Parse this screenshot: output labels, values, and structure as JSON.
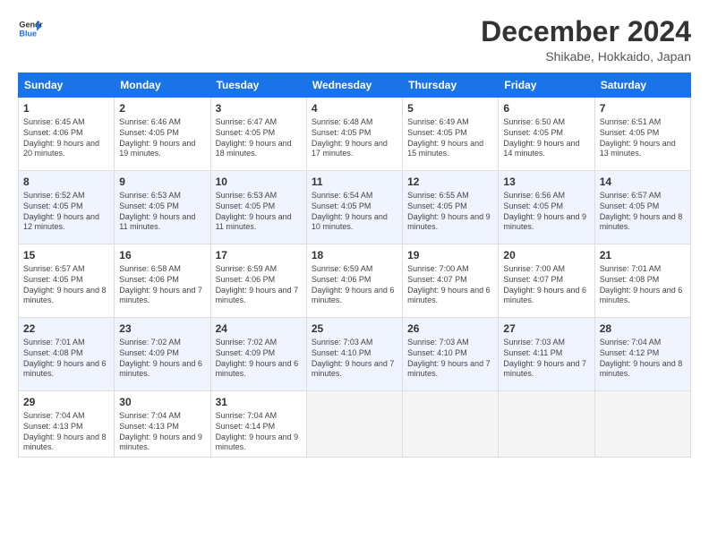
{
  "logo": {
    "line1": "General",
    "line2": "Blue"
  },
  "title": "December 2024",
  "location": "Shikabe, Hokkaido, Japan",
  "weekdays": [
    "Sunday",
    "Monday",
    "Tuesday",
    "Wednesday",
    "Thursday",
    "Friday",
    "Saturday"
  ],
  "weeks": [
    [
      {
        "day": "1",
        "sunrise": "Sunrise: 6:45 AM",
        "sunset": "Sunset: 4:06 PM",
        "daylight": "Daylight: 9 hours and 20 minutes."
      },
      {
        "day": "2",
        "sunrise": "Sunrise: 6:46 AM",
        "sunset": "Sunset: 4:05 PM",
        "daylight": "Daylight: 9 hours and 19 minutes."
      },
      {
        "day": "3",
        "sunrise": "Sunrise: 6:47 AM",
        "sunset": "Sunset: 4:05 PM",
        "daylight": "Daylight: 9 hours and 18 minutes."
      },
      {
        "day": "4",
        "sunrise": "Sunrise: 6:48 AM",
        "sunset": "Sunset: 4:05 PM",
        "daylight": "Daylight: 9 hours and 17 minutes."
      },
      {
        "day": "5",
        "sunrise": "Sunrise: 6:49 AM",
        "sunset": "Sunset: 4:05 PM",
        "daylight": "Daylight: 9 hours and 15 minutes."
      },
      {
        "day": "6",
        "sunrise": "Sunrise: 6:50 AM",
        "sunset": "Sunset: 4:05 PM",
        "daylight": "Daylight: 9 hours and 14 minutes."
      },
      {
        "day": "7",
        "sunrise": "Sunrise: 6:51 AM",
        "sunset": "Sunset: 4:05 PM",
        "daylight": "Daylight: 9 hours and 13 minutes."
      }
    ],
    [
      {
        "day": "8",
        "sunrise": "Sunrise: 6:52 AM",
        "sunset": "Sunset: 4:05 PM",
        "daylight": "Daylight: 9 hours and 12 minutes."
      },
      {
        "day": "9",
        "sunrise": "Sunrise: 6:53 AM",
        "sunset": "Sunset: 4:05 PM",
        "daylight": "Daylight: 9 hours and 11 minutes."
      },
      {
        "day": "10",
        "sunrise": "Sunrise: 6:53 AM",
        "sunset": "Sunset: 4:05 PM",
        "daylight": "Daylight: 9 hours and 11 minutes."
      },
      {
        "day": "11",
        "sunrise": "Sunrise: 6:54 AM",
        "sunset": "Sunset: 4:05 PM",
        "daylight": "Daylight: 9 hours and 10 minutes."
      },
      {
        "day": "12",
        "sunrise": "Sunrise: 6:55 AM",
        "sunset": "Sunset: 4:05 PM",
        "daylight": "Daylight: 9 hours and 9 minutes."
      },
      {
        "day": "13",
        "sunrise": "Sunrise: 6:56 AM",
        "sunset": "Sunset: 4:05 PM",
        "daylight": "Daylight: 9 hours and 9 minutes."
      },
      {
        "day": "14",
        "sunrise": "Sunrise: 6:57 AM",
        "sunset": "Sunset: 4:05 PM",
        "daylight": "Daylight: 9 hours and 8 minutes."
      }
    ],
    [
      {
        "day": "15",
        "sunrise": "Sunrise: 6:57 AM",
        "sunset": "Sunset: 4:05 PM",
        "daylight": "Daylight: 9 hours and 8 minutes."
      },
      {
        "day": "16",
        "sunrise": "Sunrise: 6:58 AM",
        "sunset": "Sunset: 4:06 PM",
        "daylight": "Daylight: 9 hours and 7 minutes."
      },
      {
        "day": "17",
        "sunrise": "Sunrise: 6:59 AM",
        "sunset": "Sunset: 4:06 PM",
        "daylight": "Daylight: 9 hours and 7 minutes."
      },
      {
        "day": "18",
        "sunrise": "Sunrise: 6:59 AM",
        "sunset": "Sunset: 4:06 PM",
        "daylight": "Daylight: 9 hours and 6 minutes."
      },
      {
        "day": "19",
        "sunrise": "Sunrise: 7:00 AM",
        "sunset": "Sunset: 4:07 PM",
        "daylight": "Daylight: 9 hours and 6 minutes."
      },
      {
        "day": "20",
        "sunrise": "Sunrise: 7:00 AM",
        "sunset": "Sunset: 4:07 PM",
        "daylight": "Daylight: 9 hours and 6 minutes."
      },
      {
        "day": "21",
        "sunrise": "Sunrise: 7:01 AM",
        "sunset": "Sunset: 4:08 PM",
        "daylight": "Daylight: 9 hours and 6 minutes."
      }
    ],
    [
      {
        "day": "22",
        "sunrise": "Sunrise: 7:01 AM",
        "sunset": "Sunset: 4:08 PM",
        "daylight": "Daylight: 9 hours and 6 minutes."
      },
      {
        "day": "23",
        "sunrise": "Sunrise: 7:02 AM",
        "sunset": "Sunset: 4:09 PM",
        "daylight": "Daylight: 9 hours and 6 minutes."
      },
      {
        "day": "24",
        "sunrise": "Sunrise: 7:02 AM",
        "sunset": "Sunset: 4:09 PM",
        "daylight": "Daylight: 9 hours and 6 minutes."
      },
      {
        "day": "25",
        "sunrise": "Sunrise: 7:03 AM",
        "sunset": "Sunset: 4:10 PM",
        "daylight": "Daylight: 9 hours and 7 minutes."
      },
      {
        "day": "26",
        "sunrise": "Sunrise: 7:03 AM",
        "sunset": "Sunset: 4:10 PM",
        "daylight": "Daylight: 9 hours and 7 minutes."
      },
      {
        "day": "27",
        "sunrise": "Sunrise: 7:03 AM",
        "sunset": "Sunset: 4:11 PM",
        "daylight": "Daylight: 9 hours and 7 minutes."
      },
      {
        "day": "28",
        "sunrise": "Sunrise: 7:04 AM",
        "sunset": "Sunset: 4:12 PM",
        "daylight": "Daylight: 9 hours and 8 minutes."
      }
    ],
    [
      {
        "day": "29",
        "sunrise": "Sunrise: 7:04 AM",
        "sunset": "Sunset: 4:13 PM",
        "daylight": "Daylight: 9 hours and 8 minutes."
      },
      {
        "day": "30",
        "sunrise": "Sunrise: 7:04 AM",
        "sunset": "Sunset: 4:13 PM",
        "daylight": "Daylight: 9 hours and 9 minutes."
      },
      {
        "day": "31",
        "sunrise": "Sunrise: 7:04 AM",
        "sunset": "Sunset: 4:14 PM",
        "daylight": "Daylight: 9 hours and 9 minutes."
      },
      null,
      null,
      null,
      null
    ]
  ]
}
